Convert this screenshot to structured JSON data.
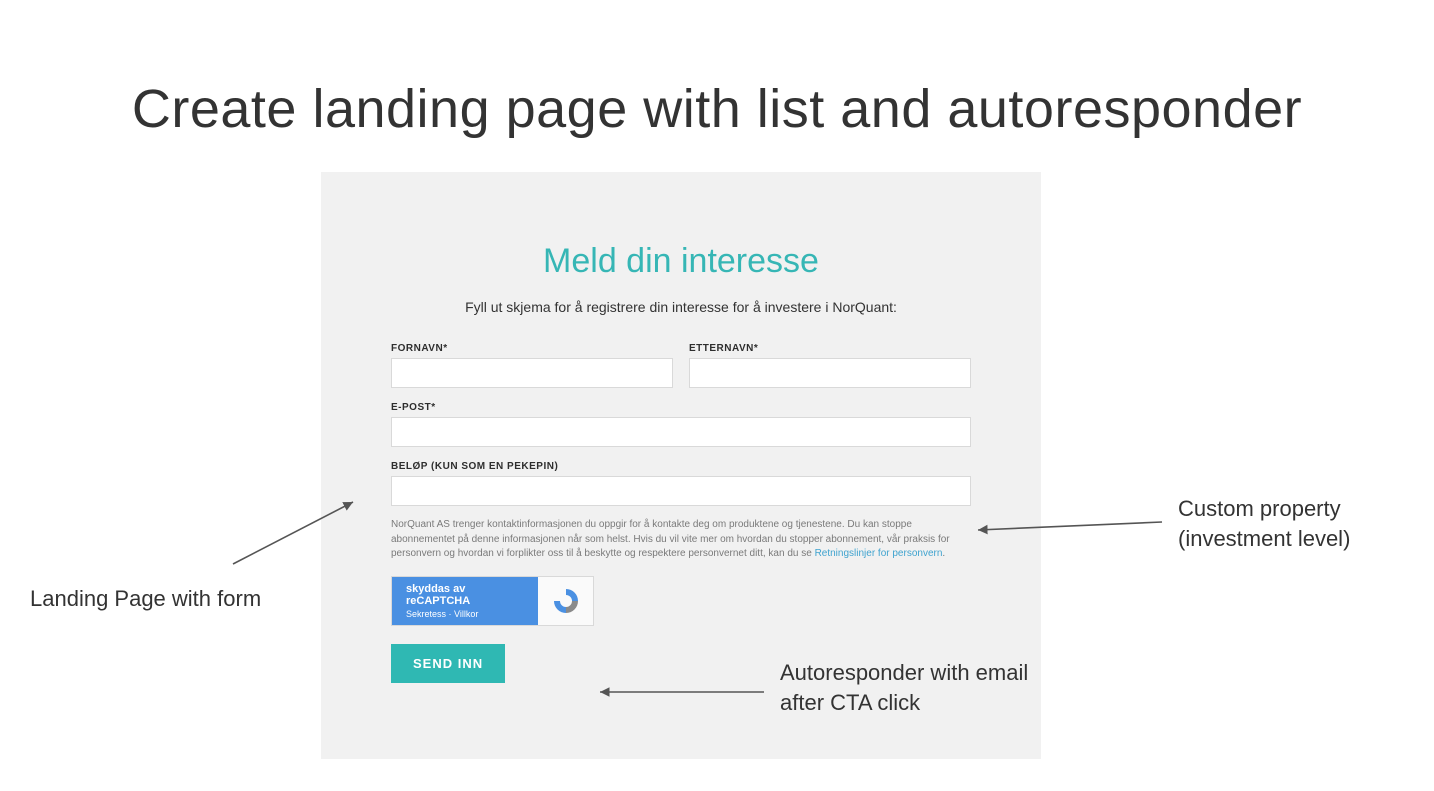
{
  "title": "Create landing page with list and autoresponder",
  "panel": {
    "heading": "Meld din interesse",
    "subtext": "Fyll ut skjema for å registrere din interesse for å investere i NorQuant:",
    "labels": {
      "firstname": "FORNAVN*",
      "lastname": "ETTERNAVN*",
      "email": "E-POST*",
      "amount": "BELØP (KUN SOM EN PEKEPIN)"
    },
    "legal_text": "NorQuant AS trenger kontaktinformasjonen du oppgir for å kontakte deg om produktene og tjenestene. Du kan stoppe abonnementet på denne informasjonen når som helst. Hvis du vil vite mer om hvordan du stopper abonnement, vår praksis for personvern og hvordan vi forplikter oss til å beskytte og respektere personvernet ditt, kan du se ",
    "legal_link": "Retningslinjer for personvern",
    "legal_suffix": ".",
    "recaptcha": {
      "line1": "skyddas av reCAPTCHA",
      "line2": "Sekretess · Villkor"
    },
    "submit": "SEND INN"
  },
  "annotations": {
    "left": "Landing Page with form",
    "right_l1": "Custom property",
    "right_l2": "(investment level)",
    "bottom_l1": "Autoresponder with email",
    "bottom_l2": "after CTA click"
  }
}
